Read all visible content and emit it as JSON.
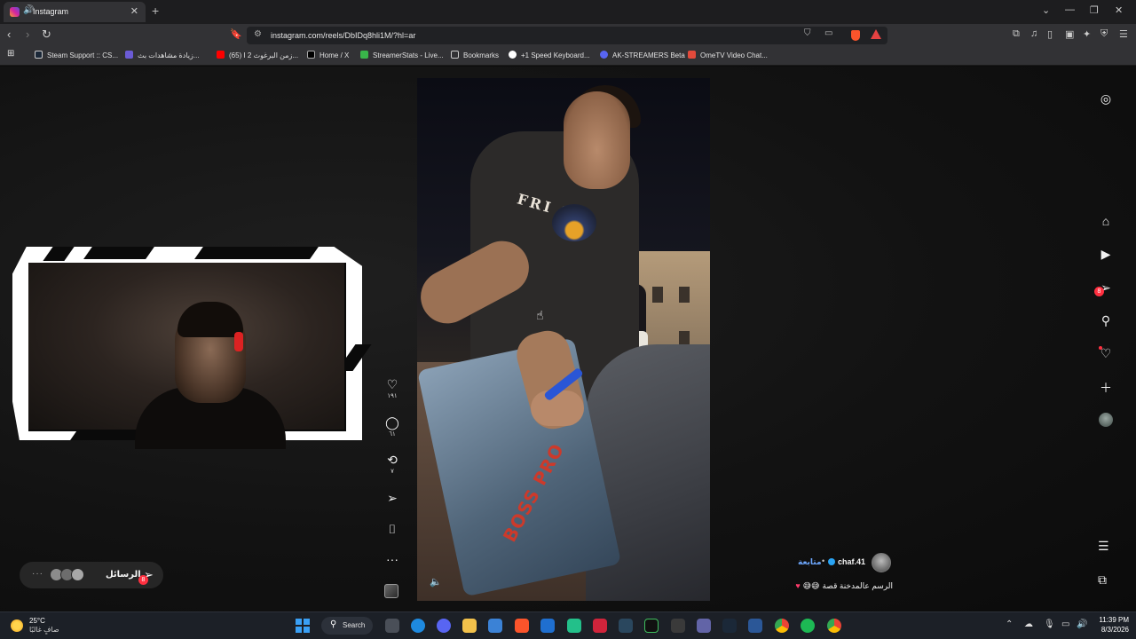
{
  "browser": {
    "tab_title": "Instagram",
    "new_tab": "+",
    "url": "instagram.com/reels/DbIDq8hli1M/?hl=ar"
  },
  "bookmarks": [
    {
      "label": "Steam Support :: CS...",
      "color": "#1b2838"
    },
    {
      "label": "زيادة مشاهدات بث...",
      "color": "#6b5bd6"
    },
    {
      "label": "(65) زمن البرغوث 2 ا...",
      "color": "#ff0000"
    },
    {
      "label": "Home / X",
      "color": "#000000"
    },
    {
      "label": "StreamerStats - Live...",
      "color": "#39b54a"
    },
    {
      "label": "Bookmarks",
      "color": "#888888"
    },
    {
      "label": "+1 Speed Keyboard...",
      "color": "#ffffff"
    },
    {
      "label": "AK-STREAMERS Beta",
      "color": "#5865f2"
    },
    {
      "label": "OmeTV Video Chat...",
      "color": "#e24a3b"
    }
  ],
  "reel": {
    "shirt_text": "FRI    S",
    "case_text": "BOSS PRO",
    "likes": "١٩١",
    "comments": "٦١",
    "reposts": "٧"
  },
  "author": {
    "username": "chaf.41",
    "follow": "متابعة",
    "caption": "الرسم عالمدخنة قصة",
    "caption_emoji": "😅😅"
  },
  "messages": {
    "label": "الرسائل",
    "badge": "8",
    "more": "···"
  },
  "nav": {
    "dm_badge": "8"
  },
  "taskbar": {
    "temp": "25°C",
    "weather": "صافٍ غالبًا",
    "search": "Search",
    "time": "11:39 PM",
    "date": "8/3/2026"
  }
}
